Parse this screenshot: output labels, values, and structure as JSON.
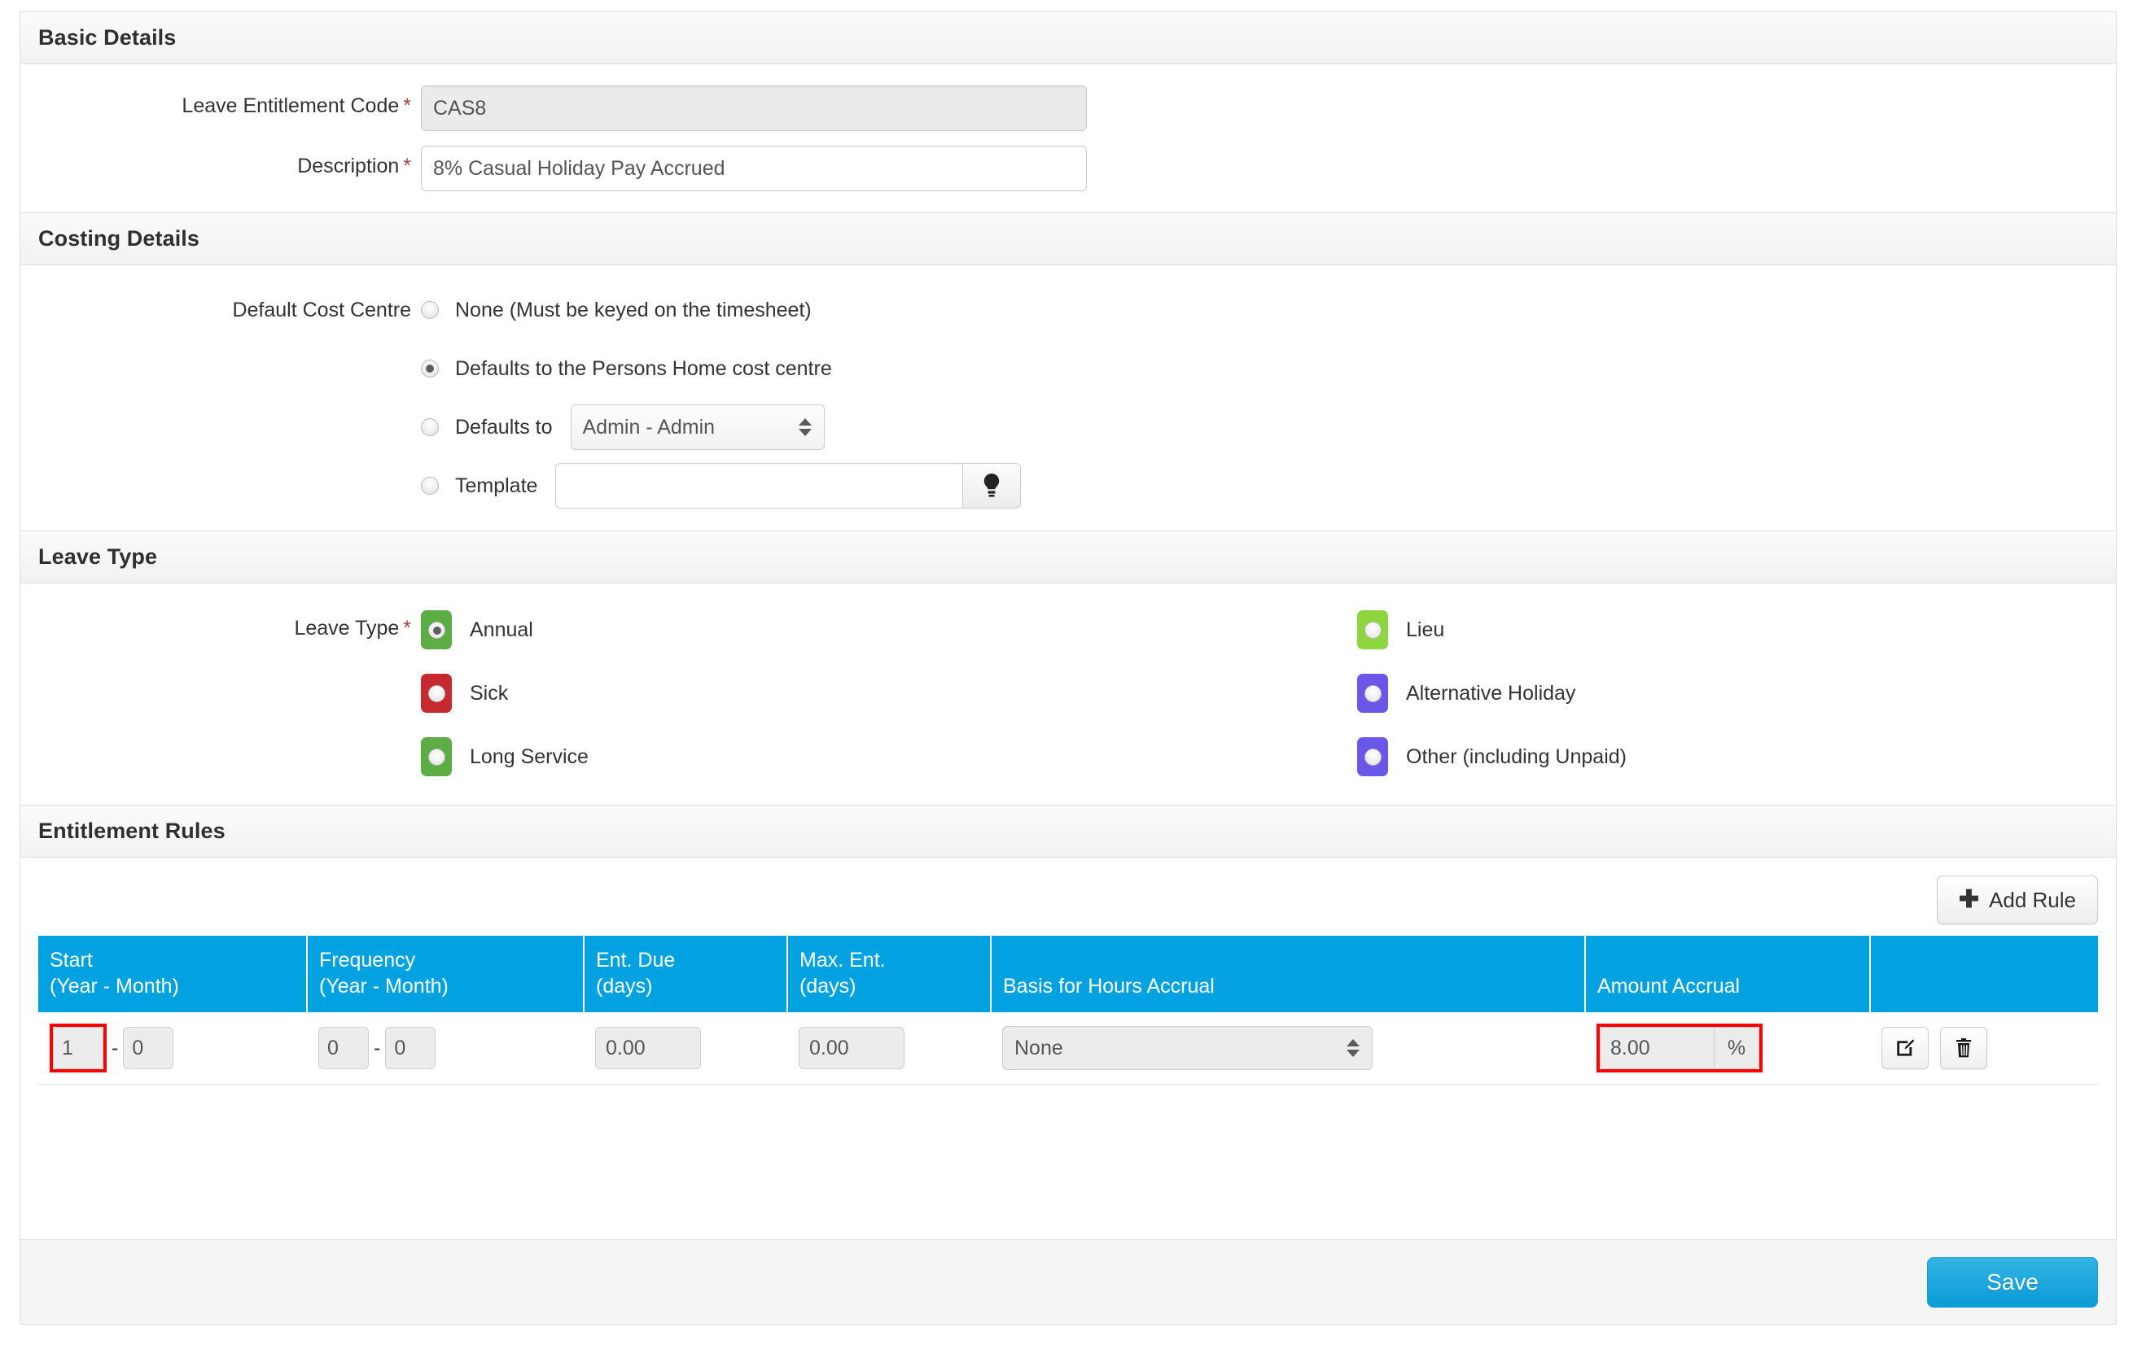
{
  "sections": {
    "basic": {
      "title": "Basic Details",
      "code_label": "Leave Entitlement Code",
      "code_value": "CAS8",
      "description_label": "Description",
      "description_value": "8% Casual Holiday Pay Accrued",
      "required_mark": "*"
    },
    "costing": {
      "title": "Costing Details",
      "label": "Default Cost Centre",
      "options": [
        {
          "label": "None (Must be keyed on the timesheet)",
          "selected": false
        },
        {
          "label": "Defaults to the Persons Home cost centre",
          "selected": true
        },
        {
          "label": "Defaults to",
          "selected": false
        },
        {
          "label": "Template",
          "selected": false
        }
      ],
      "cost_centre_selected": "Admin - Admin",
      "template_value": "",
      "template_button_icon": "lightbulb-icon"
    },
    "leave_type": {
      "title": "Leave Type",
      "label": "Leave Type",
      "required_mark": "*",
      "left": [
        {
          "label": "Annual",
          "color": "#5cad43",
          "selected": true
        },
        {
          "label": "Sick",
          "color": "#c62a30",
          "selected": false
        },
        {
          "label": "Long Service",
          "color": "#5cad43",
          "selected": false
        }
      ],
      "right": [
        {
          "label": "Lieu",
          "color": "#8ed640",
          "selected": false
        },
        {
          "label": "Alternative Holiday",
          "color": "#6a56e8",
          "selected": false
        },
        {
          "label": "Other (including Unpaid)",
          "color": "#6a56e8",
          "selected": false
        }
      ]
    },
    "rules": {
      "title": "Entitlement Rules",
      "add_rule_label": "Add Rule",
      "add_rule_icon": "plus-icon",
      "header_bg": "#02a2e0",
      "columns": [
        {
          "line1": "Start",
          "line2": "(Year - Month)"
        },
        {
          "line1": "Frequency",
          "line2": "(Year - Month)"
        },
        {
          "line1": "Ent. Due",
          "line2": "(days)"
        },
        {
          "line1": "Max. Ent.",
          "line2": "(days)"
        },
        {
          "line1": "",
          "line2": "Basis for Hours Accrual"
        },
        {
          "line1": "",
          "line2": "Amount Accrual"
        },
        {
          "line1": "",
          "line2": ""
        }
      ],
      "rows": [
        {
          "start_year": "1",
          "start_month": "0",
          "freq_year": "0",
          "freq_month": "0",
          "ent_due": "0.00",
          "max_ent": "0.00",
          "basis": "None",
          "amount": "8.00",
          "amount_unit": "%",
          "edit_icon": "edit-icon",
          "delete_icon": "trash-icon"
        }
      ],
      "separator": "-",
      "highlight_color": "#ff0000"
    }
  },
  "footer": {
    "save_label": "Save"
  }
}
